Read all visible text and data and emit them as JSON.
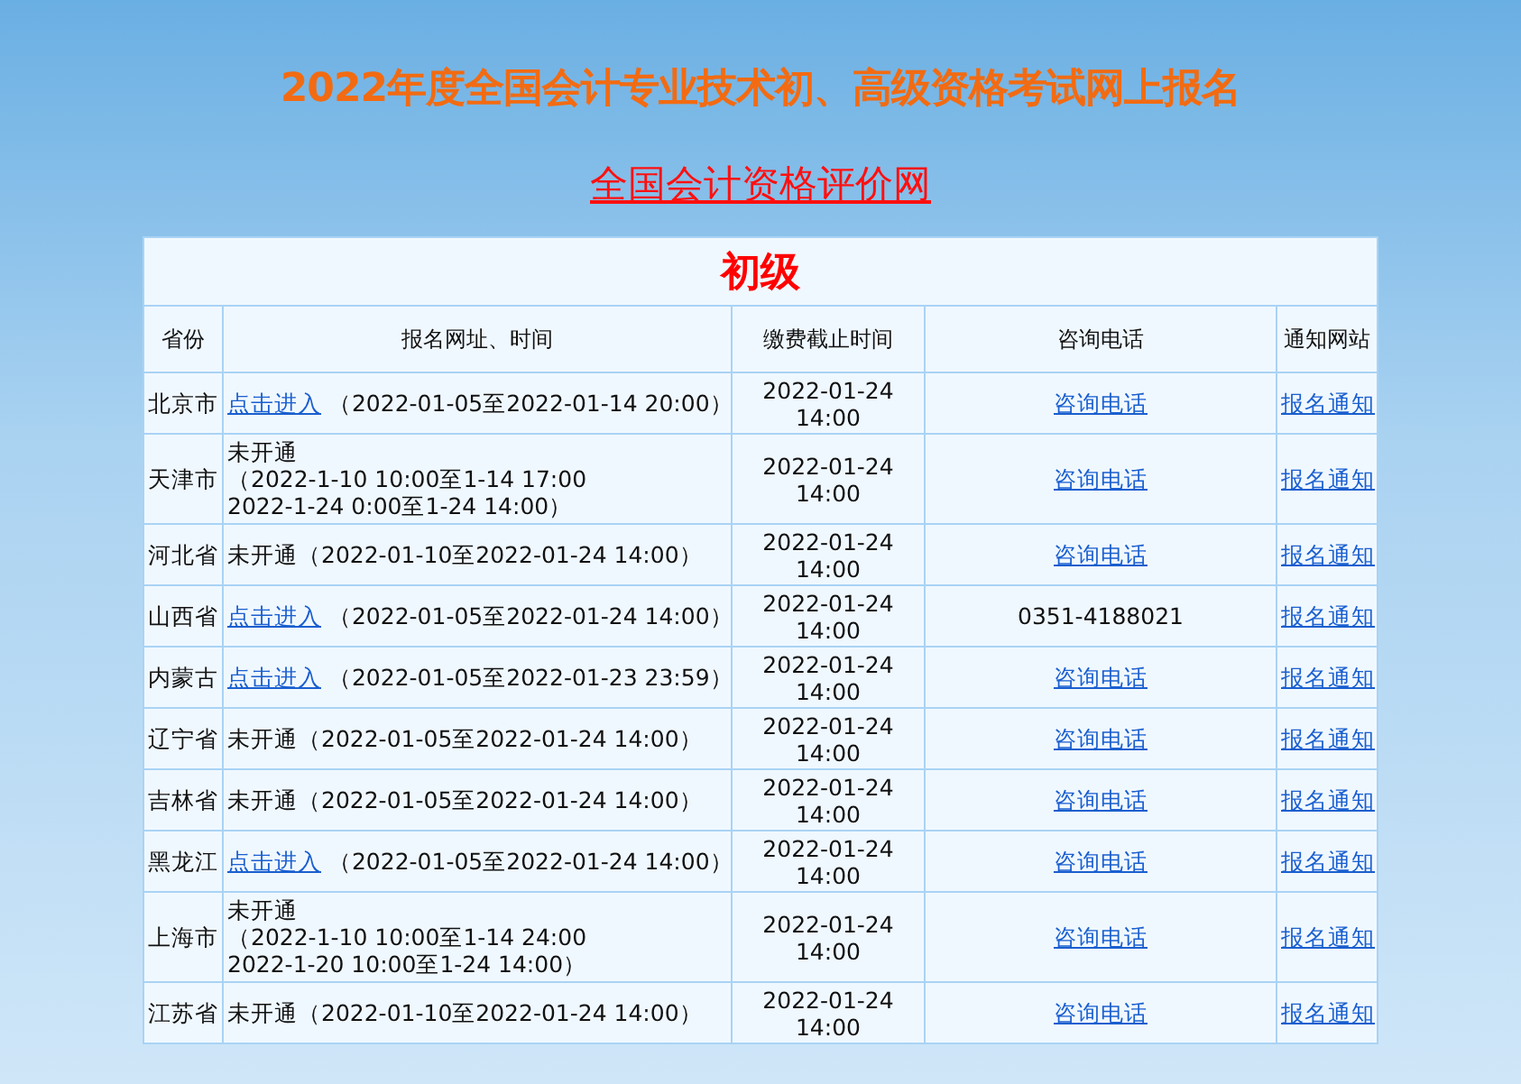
{
  "title": "2022年度全国会计专业技术初、高级资格考试网上报名",
  "site_link": "全国会计资格评价网",
  "table": {
    "level_title": "初级",
    "columns": [
      "省份",
      "报名网址、时间",
      "缴费截止时间",
      "咨询电话",
      "通知网站"
    ],
    "rows": [
      {
        "province": "北京市",
        "registration": {
          "kind": "link",
          "lead": "点击进入",
          "lines": [
            "（2022-01-05至2022-01-14 20:00）"
          ]
        },
        "deadline": [
          "2022-01-24",
          "14:00"
        ],
        "phone": {
          "kind": "link",
          "text": "咨询电话"
        },
        "notice": "报名通知"
      },
      {
        "province": "天津市",
        "registration": {
          "kind": "text",
          "lead": "未开通",
          "lines": [
            "（2022-1-10 10:00至1-14 17:00",
            "2022-1-24 0:00至1-24 14:00）"
          ]
        },
        "deadline": [
          "2022-01-24",
          "14:00"
        ],
        "phone": {
          "kind": "link",
          "text": "咨询电话"
        },
        "notice": "报名通知"
      },
      {
        "province": "河北省",
        "registration": {
          "kind": "text",
          "lead": "未开通",
          "lines": [
            "（2022-01-10至2022-01-24 14:00）"
          ]
        },
        "deadline": [
          "2022-01-24",
          "14:00"
        ],
        "phone": {
          "kind": "link",
          "text": "咨询电话"
        },
        "notice": "报名通知"
      },
      {
        "province": "山西省",
        "registration": {
          "kind": "link",
          "lead": "点击进入",
          "lines": [
            "（2022-01-05至2022-01-24 14:00）"
          ]
        },
        "deadline": [
          "2022-01-24",
          "14:00"
        ],
        "phone": {
          "kind": "text",
          "text": "0351-4188021"
        },
        "notice": "报名通知"
      },
      {
        "province": "内蒙古",
        "registration": {
          "kind": "link",
          "lead": "点击进入",
          "lines": [
            "（2022-01-05至2022-01-23 23:59）"
          ]
        },
        "deadline": [
          "2022-01-24",
          "14:00"
        ],
        "phone": {
          "kind": "link",
          "text": "咨询电话"
        },
        "notice": "报名通知"
      },
      {
        "province": "辽宁省",
        "registration": {
          "kind": "text",
          "lead": "未开通",
          "lines": [
            "（2022-01-05至2022-01-24 14:00）"
          ]
        },
        "deadline": [
          "2022-01-24",
          "14:00"
        ],
        "phone": {
          "kind": "link",
          "text": "咨询电话"
        },
        "notice": "报名通知"
      },
      {
        "province": "吉林省",
        "registration": {
          "kind": "text",
          "lead": "未开通",
          "lines": [
            "（2022-01-05至2022-01-24 14:00）"
          ]
        },
        "deadline": [
          "2022-01-24",
          "14:00"
        ],
        "phone": {
          "kind": "link",
          "text": "咨询电话"
        },
        "notice": "报名通知"
      },
      {
        "province": "黑龙江",
        "registration": {
          "kind": "link",
          "lead": "点击进入",
          "lines": [
            "（2022-01-05至2022-01-24 14:00）"
          ]
        },
        "deadline": [
          "2022-01-24",
          "14:00"
        ],
        "phone": {
          "kind": "link",
          "text": "咨询电话"
        },
        "notice": "报名通知"
      },
      {
        "province": "上海市",
        "registration": {
          "kind": "text",
          "lead": "未开通",
          "lines": [
            "（2022-1-10 10:00至1-14 24:00",
            "2022-1-20 10:00至1-24 14:00）"
          ]
        },
        "deadline": [
          "2022-01-24",
          "14:00"
        ],
        "phone": {
          "kind": "link",
          "text": "咨询电话"
        },
        "notice": "报名通知"
      },
      {
        "province": "江苏省",
        "registration": {
          "kind": "text",
          "lead": "未开通",
          "lines": [
            "（2022-01-10至2022-01-24 14:00）"
          ]
        },
        "deadline": [
          "2022-01-24",
          "14:00"
        ],
        "phone": {
          "kind": "link",
          "text": "咨询电话"
        },
        "notice": "报名通知"
      }
    ]
  }
}
